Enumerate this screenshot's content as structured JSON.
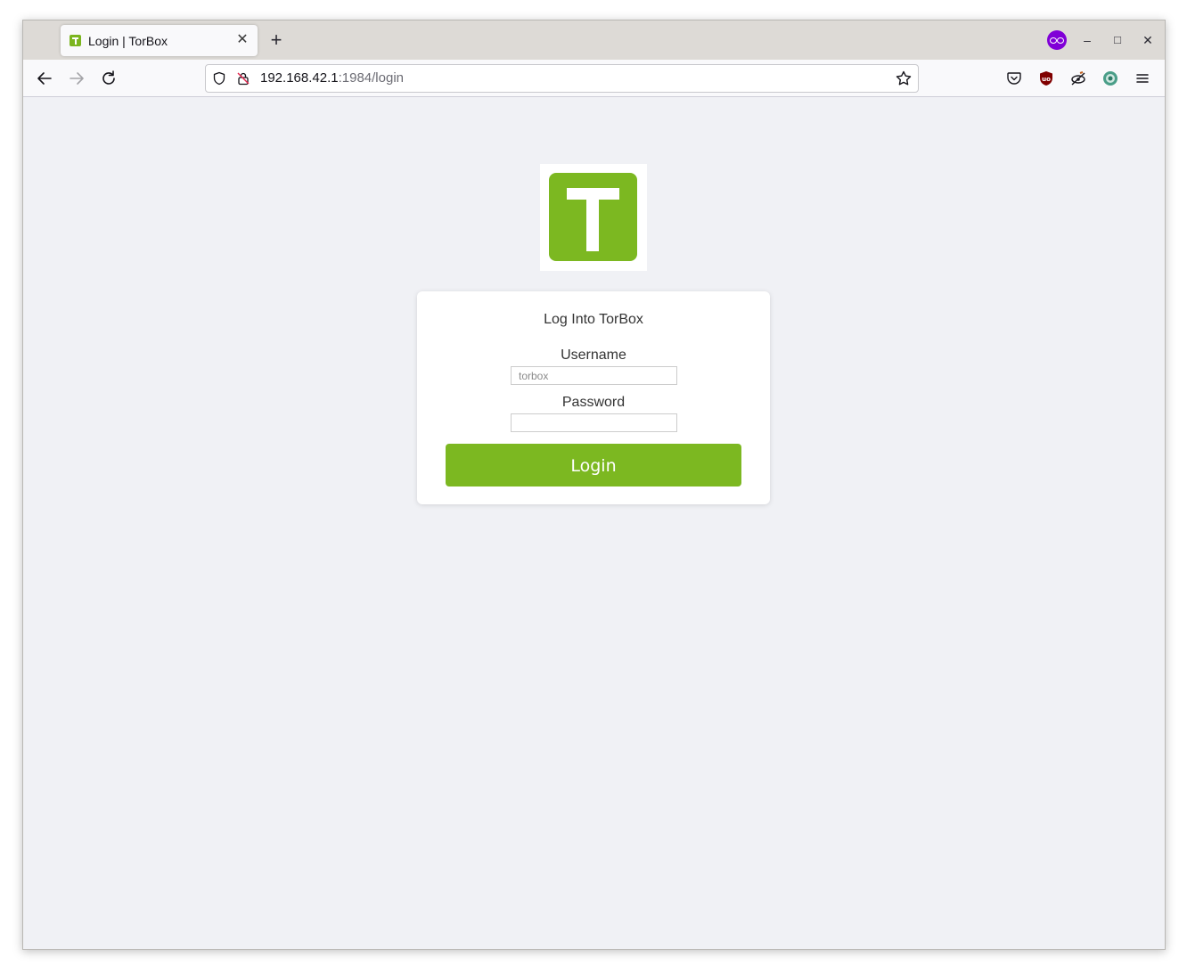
{
  "browser": {
    "tab": {
      "title": "Login | TorBox"
    },
    "address": {
      "host": "192.168.42.1",
      "path": ":1984/login"
    },
    "icons": {
      "tab_favicon": "torbox-favicon",
      "tab_close": "close-icon",
      "new_tab": "plus-icon",
      "private_mask": "private-browsing-mask-icon",
      "back": "arrow-left-icon",
      "forward": "arrow-right-icon",
      "reload": "reload-icon",
      "shield": "tracking-protection-shield-icon",
      "lock": "insecure-lock-icon",
      "bookmark": "star-icon",
      "pocket": "pocket-icon",
      "ublock": "ublock-origin-icon",
      "extension_eye": "privacy-extension-icon",
      "extension_globe": "globe-extension-icon",
      "menu": "hamburger-menu-icon"
    },
    "window_controls": {
      "minimize": "–",
      "maximize": "□",
      "close": "✕"
    }
  },
  "page": {
    "logo_icon": "torbox-logo-icon",
    "logo_letter": "T",
    "form": {
      "title": "Log Into TorBox",
      "username_label": "Username",
      "username_placeholder": "torbox",
      "password_label": "Password",
      "password_placeholder": "",
      "submit_label": "Login"
    }
  },
  "colors": {
    "brand_green": "#7cb821",
    "page_background": "#f0f1f5",
    "private_purple": "#8000d7"
  }
}
